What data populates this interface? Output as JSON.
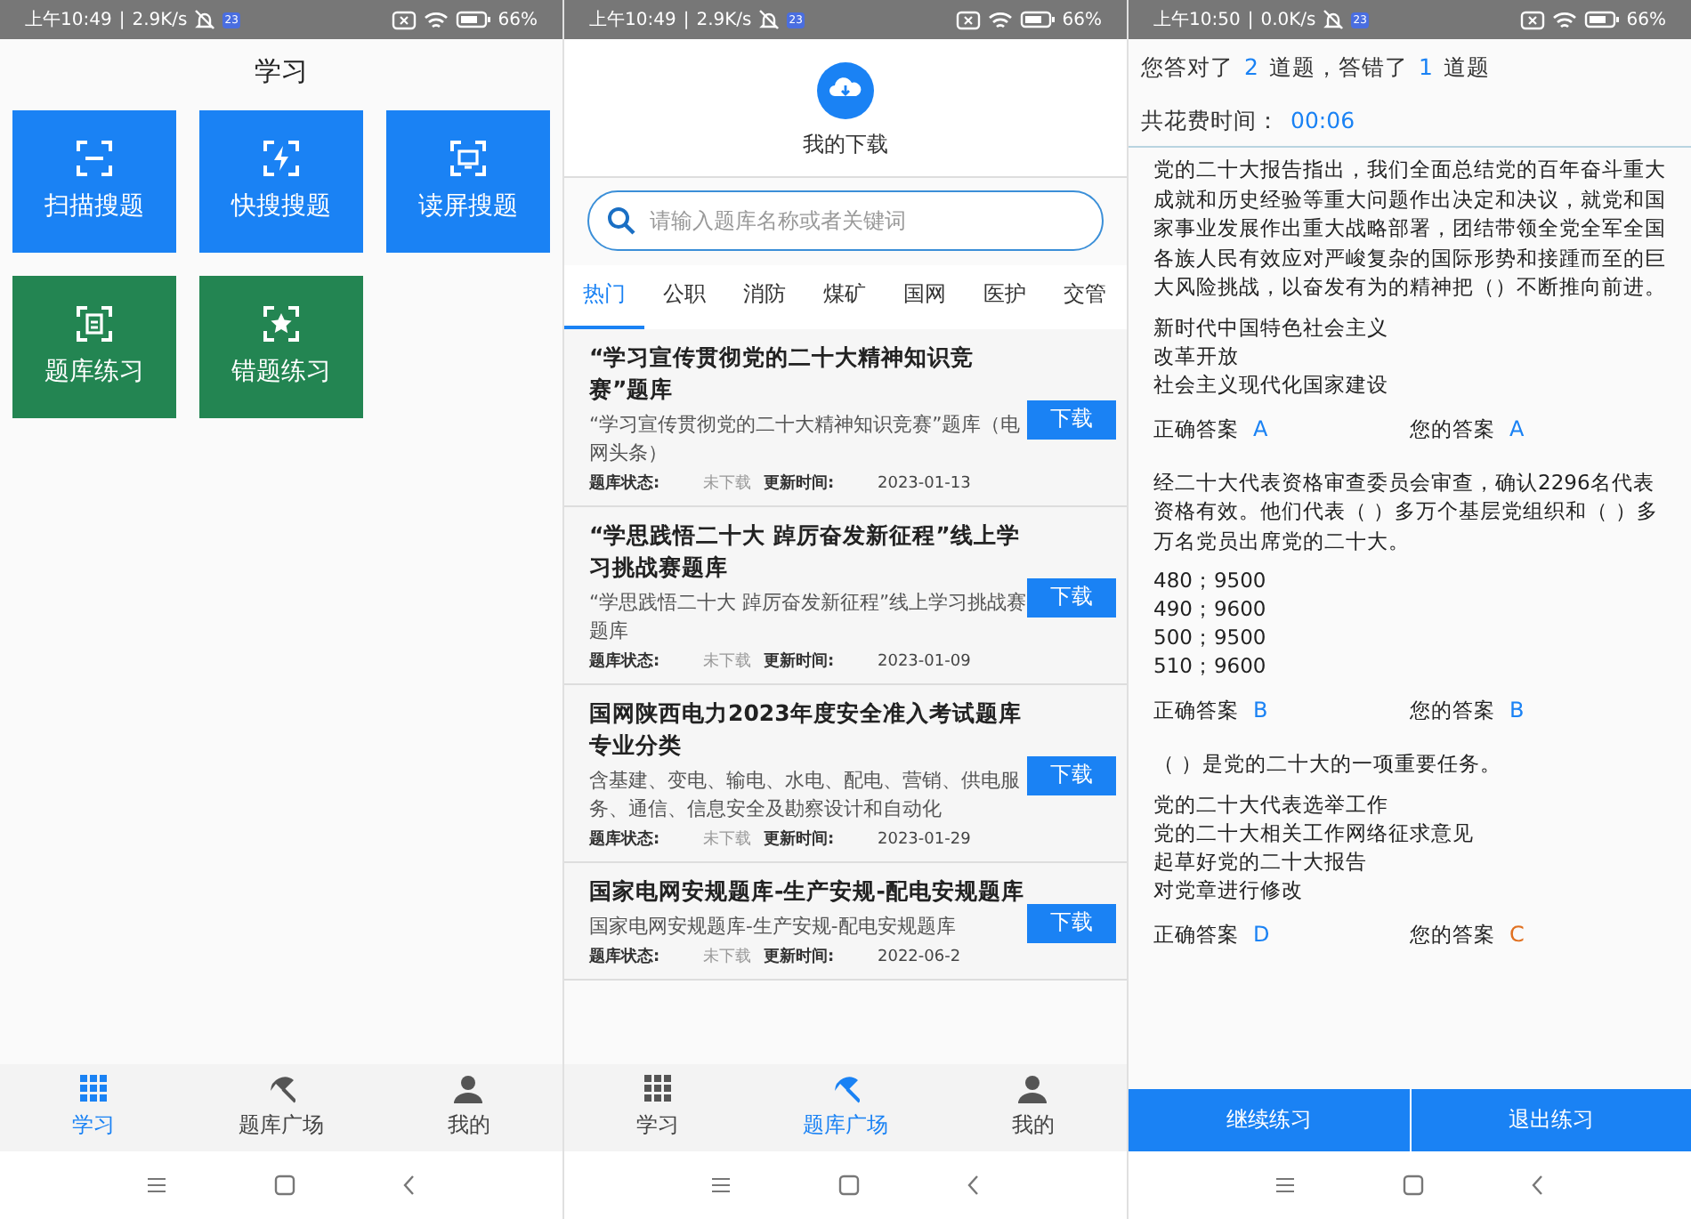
{
  "screens": [
    {
      "kind": "home",
      "status_bar": {
        "time": "上午10:49",
        "separator": "|",
        "speed": "2.9K/s",
        "badge": "23",
        "battery": "66%"
      },
      "title": "学习",
      "tiles": [
        {
          "label": "扫描搜题",
          "color": "#1a82f4"
        },
        {
          "label": "快搜搜题",
          "color": "#1a82f4"
        },
        {
          "label": "读屏搜题",
          "color": "#1a82f4"
        },
        {
          "label": "题库练习",
          "color": "#238552"
        },
        {
          "label": "错题练习",
          "color": "#238552"
        }
      ],
      "bottom_nav": [
        {
          "label": "学习",
          "selected": true
        },
        {
          "label": "题库广场",
          "selected": false
        },
        {
          "label": "我的",
          "selected": false
        }
      ]
    },
    {
      "kind": "library",
      "status_bar": {
        "time": "上午10:49",
        "separator": "|",
        "speed": "2.9K/s",
        "badge": "23",
        "battery": "66%"
      },
      "header": {
        "label": "我的下载"
      },
      "search": {
        "placeholder": "请输入题库名称或者关键词"
      },
      "tabs": [
        {
          "label": "热门",
          "selected": true
        },
        {
          "label": "公职",
          "selected": false
        },
        {
          "label": "消防",
          "selected": false
        },
        {
          "label": "煤矿",
          "selected": false
        },
        {
          "label": "国网",
          "selected": false
        },
        {
          "label": "医护",
          "selected": false
        },
        {
          "label": "交管",
          "selected": false
        }
      ],
      "banks": [
        {
          "title": "“学习宣传贯彻党的二十大精神知识竞赛”题库",
          "description": "“学习宣传贯彻党的二十大精神知识竞赛”题库（电网头条）",
          "status_label": "题库状态:",
          "status": "未下载",
          "date_label": "更新时间:",
          "date": "2023-01-13",
          "button": "下载"
        },
        {
          "title": "“学思践悟二十大 踔厉奋发新征程”线上学习挑战赛题库",
          "description": "“学思践悟二十大 踔厉奋发新征程”线上学习挑战赛题库",
          "status_label": "题库状态:",
          "status": "未下载",
          "date_label": "更新时间:",
          "date": "2023-01-09",
          "button": "下载"
        },
        {
          "title": "国网陕西电力2023年度安全准入考试题库专业分类",
          "description": "含基建、变电、输电、水电、配电、营销、供电服务、通信、信息安全及勘察设计和自动化",
          "status_label": "题库状态:",
          "status": "未下载",
          "date_label": "更新时间:",
          "date": "2023-01-29",
          "button": "下载"
        },
        {
          "title": "国家电网安规题库-生产安规-配电安规题库",
          "description": "国家电网安规题库-生产安规-配电安规题库",
          "status_label": "题库状态:",
          "status": "未下载",
          "date_label": "更新时间:",
          "date": "2022-06-2",
          "button": "下载"
        }
      ],
      "bottom_nav": [
        {
          "label": "学习",
          "selected": false
        },
        {
          "label": "题库广场",
          "selected": true
        },
        {
          "label": "我的",
          "selected": false
        }
      ]
    },
    {
      "kind": "result",
      "status_bar": {
        "time": "上午10:50",
        "separator": "|",
        "speed": "0.0K/s",
        "badge": "23",
        "battery": "66%"
      },
      "summary": {
        "text_1": "您答对了",
        "correct_count": "2",
        "text_2": "道题，答错了",
        "wrong_count": "1",
        "text_3": "道题"
      },
      "time": {
        "label": "共花费时间：",
        "value": "00:06"
      },
      "questions": [
        {
          "stem": "党的二十大报告指出，我们全面总结党的百年奋斗重大成就和历史经验等重大问题作出决定和决议，就党和国家事业发展作出重大战略部署，团结带领全党全军全国各族人民有效应对严峻复杂的国际形势和接踵而至的巨大风险挑战，以奋发有为的精神把（）不断推向前进。",
          "options": [
            "新时代中国特色社会主义",
            "改革开放",
            "社会主义现代化国家建设"
          ],
          "correct_label": "正确答案",
          "correct": "A",
          "your_label": "您的答案",
          "yours": "A",
          "your_correct": true
        },
        {
          "stem": "经二十大代表资格审查委员会审查，确认2296名代表资格有效。他们代表（ ）多万个基层党组织和（ ）多万名党员出席党的二十大。",
          "options": [
            "480；9500",
            "490；9600",
            "500；9500",
            "510；9600"
          ],
          "correct_label": "正确答案",
          "correct": "B",
          "your_label": "您的答案",
          "yours": "B",
          "your_correct": true
        },
        {
          "stem": "（ ）是党的二十大的一项重要任务。",
          "options": [
            "党的二十大代表选举工作",
            "党的二十大相关工作网络征求意见",
            "起草好党的二十大报告",
            "对党章进行修改"
          ],
          "correct_label": "正确答案",
          "correct": "D",
          "your_label": "您的答案",
          "yours": "C",
          "your_correct": false
        }
      ],
      "buttons": [
        "继续练习",
        "退出练习"
      ]
    }
  ]
}
